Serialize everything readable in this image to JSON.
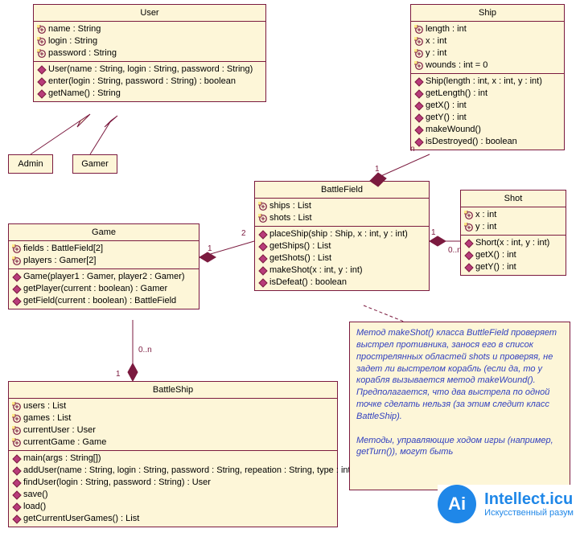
{
  "classes": {
    "user": {
      "name": "User",
      "attrs": [
        {
          "icon": "attr",
          "text": "name : String"
        },
        {
          "icon": "attr",
          "text": "login : String"
        },
        {
          "icon": "attr",
          "text": "password : String"
        }
      ],
      "ops": [
        {
          "icon": "op",
          "text": "User(name : String, login : String, password : String)"
        },
        {
          "icon": "op",
          "text": "enter(login : String, password : String) : boolean"
        },
        {
          "icon": "op",
          "text": "getName() : String"
        }
      ]
    },
    "admin": {
      "name": "Admin"
    },
    "gamer": {
      "name": "Gamer"
    },
    "ship": {
      "name": "Ship",
      "attrs": [
        {
          "icon": "attr",
          "text": "length : int"
        },
        {
          "icon": "attr",
          "text": "x : int"
        },
        {
          "icon": "attr",
          "text": "y : int"
        },
        {
          "icon": "attr",
          "text": "wounds : int = 0"
        }
      ],
      "ops": [
        {
          "icon": "op",
          "text": "Ship(length : int, x : int, y : int)"
        },
        {
          "icon": "op",
          "text": "getLength() : int"
        },
        {
          "icon": "op",
          "text": "getX() : int"
        },
        {
          "icon": "op",
          "text": "getY() : int"
        },
        {
          "icon": "op",
          "text": "makeWound()"
        },
        {
          "icon": "op",
          "text": "isDestroyed() : boolean"
        }
      ]
    },
    "battlefield": {
      "name": "BattleField",
      "attrs": [
        {
          "icon": "attr",
          "text": "ships : List"
        },
        {
          "icon": "attr",
          "text": "shots : List"
        }
      ],
      "ops": [
        {
          "icon": "op",
          "text": "placeShip(ship : Ship, x : int, y : int)"
        },
        {
          "icon": "op",
          "text": "getShips() : List"
        },
        {
          "icon": "op",
          "text": "getShots() : List"
        },
        {
          "icon": "op",
          "text": "makeShot(x : int, y : int)"
        },
        {
          "icon": "op",
          "text": "isDefeat() : boolean"
        }
      ]
    },
    "shot": {
      "name": "Shot",
      "attrs": [
        {
          "icon": "attr",
          "text": "x : int"
        },
        {
          "icon": "attr",
          "text": "y : int"
        }
      ],
      "ops": [
        {
          "icon": "op",
          "text": "Short(x : int, y : int)"
        },
        {
          "icon": "op",
          "text": "getX() : int"
        },
        {
          "icon": "op",
          "text": "getY() : int"
        }
      ]
    },
    "game": {
      "name": "Game",
      "attrs": [
        {
          "icon": "attr",
          "text": "fields : BattleField[2]"
        },
        {
          "icon": "attr",
          "text": "players : Gamer[2]"
        }
      ],
      "ops": [
        {
          "icon": "op",
          "text": "Game(player1 : Gamer, player2 : Gamer)"
        },
        {
          "icon": "op",
          "text": "getPlayer(current : boolean) : Gamer"
        },
        {
          "icon": "op",
          "text": "getField(current : boolean) : BattleField"
        }
      ]
    },
    "battleship": {
      "name": "BattleShip",
      "attrs": [
        {
          "icon": "attr",
          "text": "users : List"
        },
        {
          "icon": "attr",
          "text": "games : List"
        },
        {
          "icon": "attr",
          "text": "currentUser : User"
        },
        {
          "icon": "attr",
          "text": "currentGame : Game"
        }
      ],
      "ops": [
        {
          "icon": "op",
          "text": "main(args : String[])"
        },
        {
          "icon": "op",
          "text": "addUser(name : String, login : String, password : String, repeation : String, type : int)"
        },
        {
          "icon": "op",
          "text": "findUser(login : String, password : String) : User"
        },
        {
          "icon": "op",
          "text": "save()"
        },
        {
          "icon": "op",
          "text": "load()"
        },
        {
          "icon": "op",
          "text": "getCurrentUserGames() : List"
        }
      ]
    }
  },
  "note": "Метод makeShot() класса ButtleField проверяет выстрел противника, занося его в список прострелянных областей shots и проверяя, не задет ли выстрелом корабль (если да, то у корабля вызывается метод makeWound(). Предполагается, что два выстрела по одной точке сделать нельзя (за этим следит класс BattleShip).\n\nМетоды, управляющие ходом игры (например, getTurn()), могут быть",
  "mult": {
    "bf_ship_l": "1",
    "bf_ship_r": "n",
    "bf_shot_l": "1",
    "bf_shot_r": "0..n",
    "game_bf_l": "1",
    "game_bf_r": "2",
    "bs_game_l": "1",
    "bs_game_r": "0..n"
  },
  "logo": {
    "title": "Intellect.icu",
    "sub": "Искусственный разум",
    "mark": "Ai"
  }
}
